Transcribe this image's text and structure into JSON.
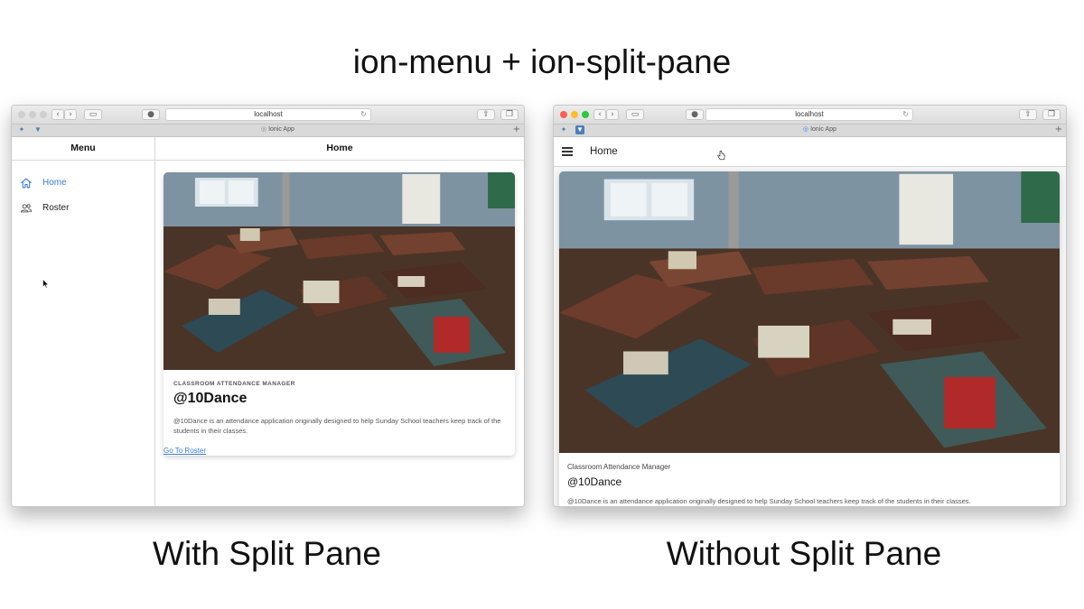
{
  "headline": "ion-menu + ion-split-pane",
  "captions": {
    "left": "With Split Pane",
    "right": "Without Split Pane"
  },
  "browser": {
    "url": "localhost",
    "tab_title": "Ionic App",
    "tab_icons": [
      "twitter-icon",
      "bookmark-icon"
    ],
    "traffic_lights": {
      "close": "#fc5f57",
      "minimize": "#fdbc2e",
      "zoom": "#28c840"
    }
  },
  "split_pane": {
    "menu_title": "Menu",
    "menu_items": [
      {
        "label": "Home",
        "icon": "home-icon",
        "active": true
      },
      {
        "label": "Roster",
        "icon": "people-icon",
        "active": false
      }
    ],
    "content_title": "Home",
    "card": {
      "subtitle": "CLASSROOM ATTENDANCE MANAGER",
      "title": "@10Dance",
      "body": "@10Dance is an attendance application originally designed to help Sunday School teachers keep track of the students in their classes.",
      "link": "Go To Roster"
    }
  },
  "no_split_pane": {
    "header_title": "Home",
    "card": {
      "subtitle": "Classroom Attendance Manager",
      "title": "@10Dance",
      "body": "@10Dance is an attendance application originally designed to help Sunday School teachers keep track of the students in their classes."
    }
  },
  "colors": {
    "accent": "#3880ff",
    "active_menu_text": "#3a7bd5"
  }
}
